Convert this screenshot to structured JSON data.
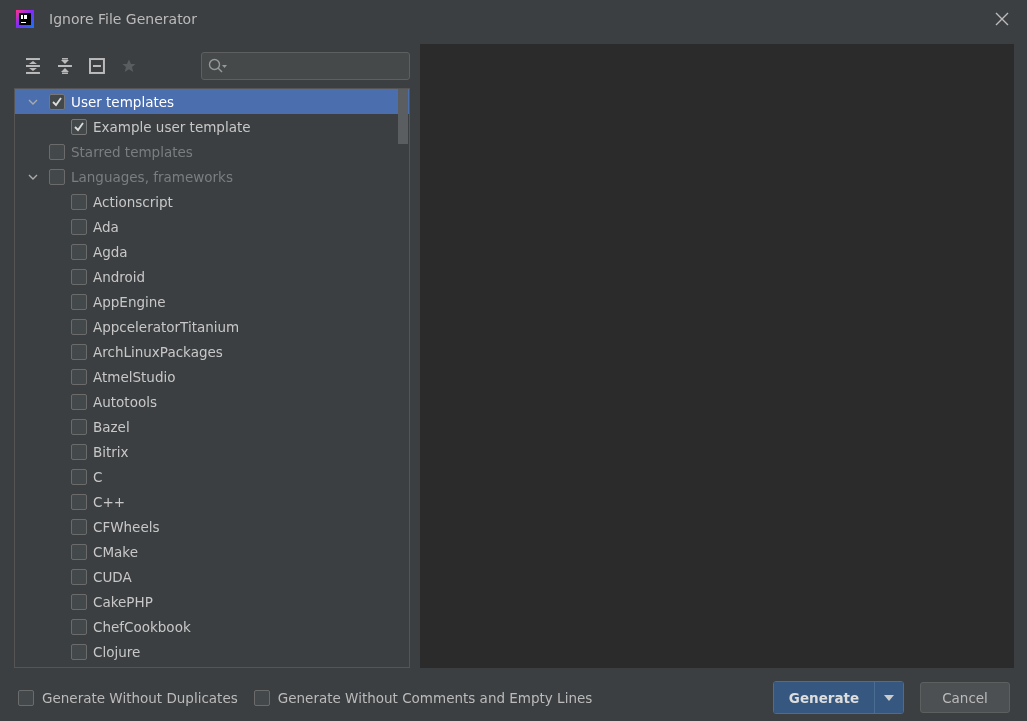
{
  "window": {
    "title": "Ignore File Generator"
  },
  "tree": [
    {
      "label": "User templates",
      "checked": true,
      "selected": true,
      "disabled": false,
      "expanded": true,
      "children": [
        {
          "label": "Example user template",
          "checked": true,
          "selected": false,
          "disabled": false
        }
      ]
    },
    {
      "label": "Starred templates",
      "checked": false,
      "selected": false,
      "disabled": true
    },
    {
      "label": "Languages, frameworks",
      "checked": false,
      "selected": false,
      "disabled": true,
      "expanded": true,
      "children": [
        {
          "label": "Actionscript",
          "checked": false,
          "selected": false,
          "disabled": false
        },
        {
          "label": "Ada",
          "checked": false,
          "selected": false,
          "disabled": false
        },
        {
          "label": "Agda",
          "checked": false,
          "selected": false,
          "disabled": false
        },
        {
          "label": "Android",
          "checked": false,
          "selected": false,
          "disabled": false
        },
        {
          "label": "AppEngine",
          "checked": false,
          "selected": false,
          "disabled": false
        },
        {
          "label": "AppceleratorTitanium",
          "checked": false,
          "selected": false,
          "disabled": false
        },
        {
          "label": "ArchLinuxPackages",
          "checked": false,
          "selected": false,
          "disabled": false
        },
        {
          "label": "AtmelStudio",
          "checked": false,
          "selected": false,
          "disabled": false
        },
        {
          "label": "Autotools",
          "checked": false,
          "selected": false,
          "disabled": false
        },
        {
          "label": "Bazel",
          "checked": false,
          "selected": false,
          "disabled": false
        },
        {
          "label": "Bitrix",
          "checked": false,
          "selected": false,
          "disabled": false
        },
        {
          "label": "C",
          "checked": false,
          "selected": false,
          "disabled": false
        },
        {
          "label": "C++",
          "checked": false,
          "selected": false,
          "disabled": false
        },
        {
          "label": "CFWheels",
          "checked": false,
          "selected": false,
          "disabled": false
        },
        {
          "label": "CMake",
          "checked": false,
          "selected": false,
          "disabled": false
        },
        {
          "label": "CUDA",
          "checked": false,
          "selected": false,
          "disabled": false
        },
        {
          "label": "CakePHP",
          "checked": false,
          "selected": false,
          "disabled": false
        },
        {
          "label": "ChefCookbook",
          "checked": false,
          "selected": false,
          "disabled": false
        },
        {
          "label": "Clojure",
          "checked": false,
          "selected": false,
          "disabled": false
        }
      ]
    }
  ],
  "options": [
    {
      "label": "Generate Without Duplicates",
      "checked": false
    },
    {
      "label": "Generate Without Comments and Empty Lines",
      "checked": false
    }
  ],
  "buttons": [
    {
      "label": "Generate",
      "kind": "primary"
    },
    {
      "label": "Cancel",
      "kind": "secondary"
    }
  ]
}
